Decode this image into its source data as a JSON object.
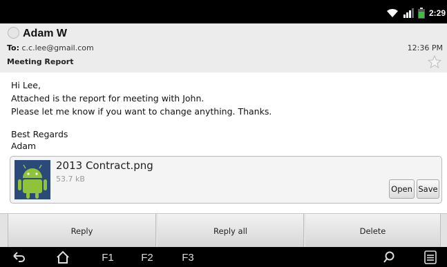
{
  "status_bar": {
    "time": "2:29",
    "icons": [
      "wifi-icon",
      "signal-icon",
      "battery-icon"
    ]
  },
  "header": {
    "sender": "Adam W",
    "to_label": "To:",
    "to_value": "c.c.lee@gmail.com",
    "time": "12:36 PM",
    "subject": "Meeting Report"
  },
  "message": {
    "line1": "Hi Lee,",
    "line2": "Attached is the report for meeting with John.",
    "line3": "Please let me know if you want to change anything. Thanks.",
    "line4": "Best Regards",
    "line5": "Adam"
  },
  "attachment": {
    "name": "2013 Contract.png",
    "size": "53.7 kB",
    "open_label": "Open",
    "save_label": "Save"
  },
  "actions": {
    "reply": "Reply",
    "reply_all": "Reply all",
    "delete": "Delete"
  },
  "navbar": {
    "f1": "F1",
    "f2": "F2",
    "f3": "F3"
  },
  "colors": {
    "header_bg": "#ececec",
    "android_green": "#8fc43a",
    "battery_green": "#3fbf3f"
  }
}
